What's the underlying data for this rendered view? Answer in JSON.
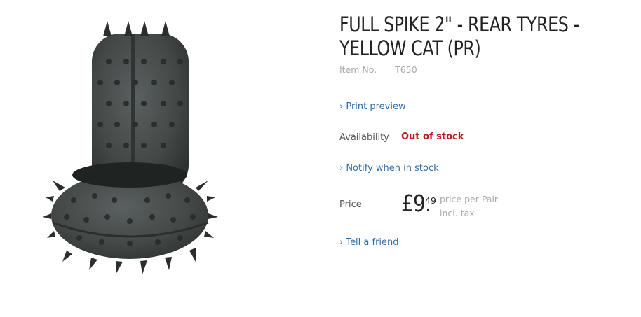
{
  "product": {
    "title": "FULL SPIKE 2\" - REAR TYRES - YELLOW CAT (PR)",
    "item_no_label": "Item No.",
    "item_no_value": "T650",
    "image_alt": "spiked rear tyres"
  },
  "links": {
    "print_preview": "› Print preview",
    "notify": "› Notify when in stock",
    "tell_friend": "› Tell a friend"
  },
  "availability": {
    "label": "Availability",
    "value": "Out of stock"
  },
  "price": {
    "label": "Price",
    "main": "£9.",
    "cents": "49",
    "per": "price per Pair",
    "tax": "incl. tax"
  },
  "colors": {
    "link": "#2f6ea5",
    "out_of_stock": "#b71c1c",
    "tyre": "#3d4342"
  }
}
